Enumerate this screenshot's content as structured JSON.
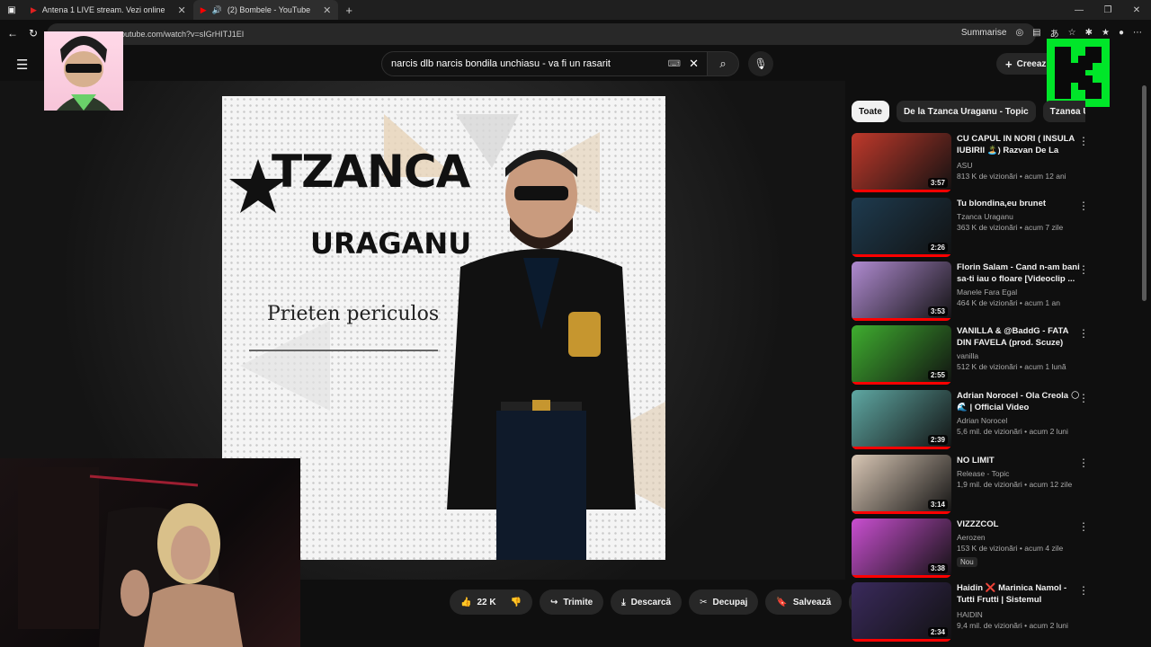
{
  "browser": {
    "tabs": [
      {
        "title": "Antena 1 LIVE stream. Vezi online"
      },
      {
        "title": "(2) Bombele - YouTube"
      }
    ],
    "url": "outube.com/watch?v=sIGrHITJ1EI",
    "summarise_label": "Summarise"
  },
  "youtube": {
    "search_value": "narcis dlb narcis bondila unchiasu - va fi un rasarit",
    "create_label": "Creeaz"
  },
  "artwork": {
    "title_line1": "TZANCA",
    "title_line2": "URAGANU",
    "subtitle": "Prieten periculos"
  },
  "actions": {
    "likes": "22 K",
    "share": "Trimite",
    "download": "Descarcă",
    "clip": "Decupaj",
    "save": "Salvează"
  },
  "chips": [
    {
      "label": "Toate",
      "active": true
    },
    {
      "label": "De la Tzanca Uraganu - Topic",
      "active": false
    },
    {
      "label": "Tzanca U",
      "active": false
    }
  ],
  "recommendations": [
    {
      "title": "CU CAPUL IN NORI ( INSULA IUBIRII 🏝️) Razvan De La Pitesti",
      "channel": "ASU",
      "stats": "813 K de vizionări • acum 12 ani",
      "duration": "3:57",
      "thumb_color": "#c0392b"
    },
    {
      "title": "Tu blondina,eu brunet",
      "channel": "Tzanca Uraganu",
      "stats": "363 K de vizionări • acum 7 zile",
      "duration": "2:26",
      "thumb_color": "#1e3b4f"
    },
    {
      "title": "Florin Salam - Cand n-am bani sa-ti iau o floare [Videoclip ...",
      "channel": "Manele Fara Egal",
      "stats": "464 K de vizionări • acum 1 an",
      "duration": "3:53",
      "thumb_color": "#b08bd1"
    },
    {
      "title": "VANILLA & @BaddG - FATA DIN FAVELA (prod. Scuze)",
      "channel": "vanilla",
      "stats": "512 K de vizionări • acum 1 lună",
      "duration": "2:55",
      "thumb_color": "#3fae2f"
    },
    {
      "title": "Adrian Norocel - Ola Creola 🌕 🌊 | Official Video",
      "channel": "Adrian Norocel",
      "stats": "5,6 mil. de vizionări • acum 2 luni",
      "duration": "2:39",
      "thumb_color": "#5fa8a3"
    },
    {
      "title": "NO LIMIT",
      "channel": "Release - Topic",
      "stats": "1,9 mil. de vizionări • acum 12 zile",
      "duration": "3:14",
      "thumb_color": "#d9c7b5"
    },
    {
      "title": "VIZZZCOL",
      "channel": "Aerozen",
      "stats": "153 K de vizionări • acum 4 zile",
      "duration": "3:38",
      "thumb_color": "#c94fd0",
      "badge": "Nou"
    },
    {
      "title": "Haidin ❌ Marinica Namol - Tutti Frutti | Sistemul Anacond...",
      "channel": "HAIDIN",
      "stats": "9,4 mil. de vizionări • acum 2 luni",
      "duration": "2:34",
      "thumb_color": "#3a2a5c"
    }
  ]
}
